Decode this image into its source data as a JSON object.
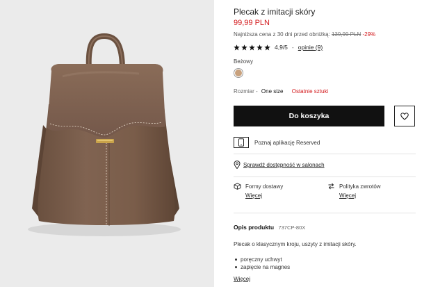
{
  "product": {
    "title": "Plecak z imitacji skóry",
    "price": "99,99 PLN",
    "lowest_label": "Najniższa cena z 30 dni przed obniżką:",
    "lowest_price": "139,99 PLN",
    "discount": "-29%",
    "rating_score": "4,9/5",
    "rating_separator": "-",
    "reviews_link": "opinie (9)",
    "stars": 5
  },
  "color": {
    "label": "Beżowy",
    "swatch_hex": "#c8a17d"
  },
  "size": {
    "label": "Rozmiar -",
    "value": "One size",
    "stock_note": "Ostatnie sztuki"
  },
  "actions": {
    "add_to_cart": "Do koszyka",
    "wishlist_icon": "heart-icon",
    "app_text": "Poznaj aplikację Reserved",
    "check_stores": "Sprawdź dostępność w salonach"
  },
  "shipping": {
    "delivery_title": "Formy dostawy",
    "delivery_link": "Więcej",
    "returns_title": "Polityka zwrotów",
    "returns_link": "Więcej"
  },
  "description": {
    "title": "Opis produktu",
    "code": "737CP-80X",
    "text": "Plecak o klasycznym kroju, uszyty z imitacji skóry.",
    "bullets": [
      "poręczny uchwyt",
      "zapięcie na magnes"
    ],
    "more_link": "Więcej"
  },
  "colors": {
    "accent_red": "#d3191c",
    "button_black": "#111111",
    "bag_brown": "#7b5f4b"
  }
}
